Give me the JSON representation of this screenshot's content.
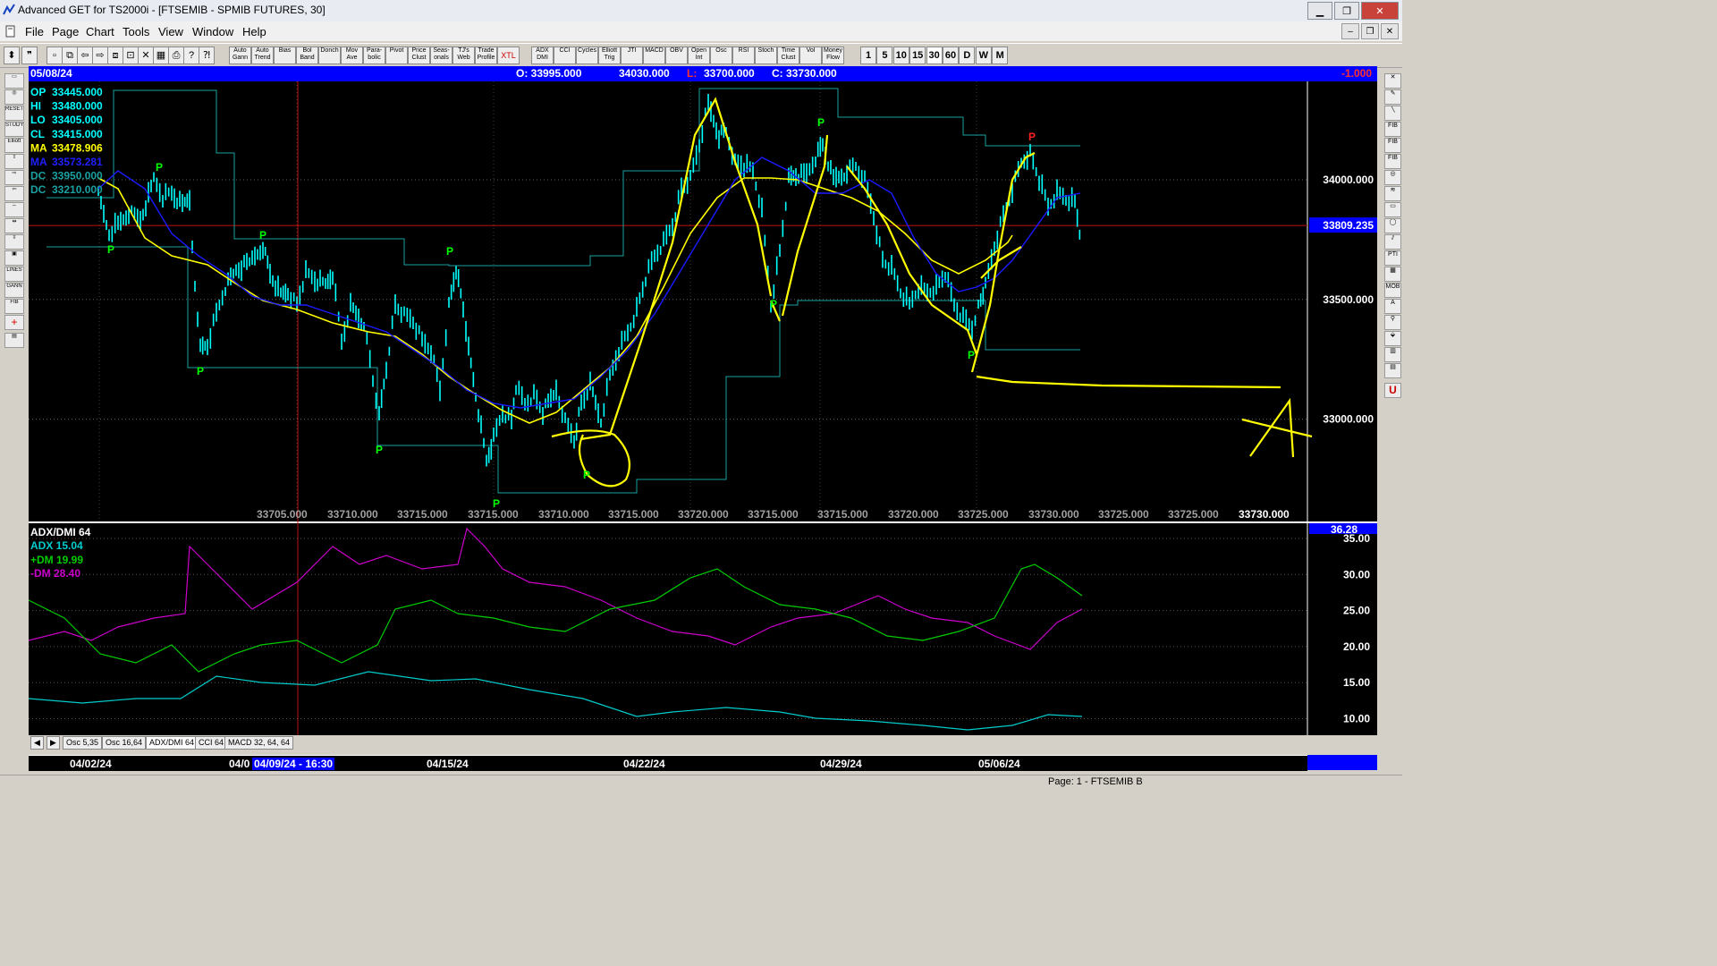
{
  "window": {
    "title": "Advanced GET for TS2000i - [FTSEMIB - SPMIB FUTURES, 30]"
  },
  "menu": [
    "File",
    "Page",
    "Chart",
    "Tools",
    "View",
    "Window",
    "Help"
  ],
  "toolbar": {
    "studies": [
      "Auto Gann",
      "Auto Trend",
      "Bias",
      "Bol Band",
      "Donch",
      "Mov Ave",
      "Para-bolic",
      "Pivot",
      "Price Clust",
      "Seas-onals",
      "TJ's Web",
      "Trade Profile",
      "XTL",
      "ADX DMI",
      "CCI",
      "Cycles",
      "Elliott Trig",
      "JTI",
      "MACD",
      "OBV",
      "Open Int",
      "Osc",
      "RSI",
      "Stoch",
      "Time Clust",
      "Vol",
      "Money Flow"
    ],
    "intervals": [
      "1",
      "5",
      "10",
      "15",
      "30",
      "60",
      "D",
      "W",
      "M"
    ]
  },
  "infobar": {
    "date": "05/08/24",
    "open": "O: 33995.000",
    "high": "34030.000",
    "low_label": "L:",
    "low": "33700.000",
    "close": "C: 33730.000",
    "change": "-1.000"
  },
  "legend": [
    {
      "label": "OP",
      "value": "33445.000",
      "color": "#00ffff"
    },
    {
      "label": "HI",
      "value": "33480.000",
      "color": "#00ffff"
    },
    {
      "label": "LO",
      "value": "33405.000",
      "color": "#00ffff"
    },
    {
      "label": "CL",
      "value": "33415.000",
      "color": "#00ffff"
    },
    {
      "label": "MA",
      "value": "33478.906",
      "color": "#ffff00"
    },
    {
      "label": "MA",
      "value": "33573.281",
      "color": "#2020ff"
    },
    {
      "label": "DC",
      "value": "33950.000",
      "color": "#1aa0a0"
    },
    {
      "label": "DC",
      "value": "33210.000",
      "color": "#1aa0a0"
    }
  ],
  "price_scale": [
    "34000.000",
    "33500.000",
    "33000.000"
  ],
  "current_price": "33809.235",
  "bottom_values": [
    "33705.000",
    "33710.000",
    "33715.000",
    "33715.000",
    "33710.000",
    "33715.000",
    "33720.000",
    "33715.000",
    "33715.000",
    "33720.000",
    "33725.000",
    "33730.000",
    "33725.000",
    "33725.000",
    "33730.000"
  ],
  "pivots": [
    "P",
    "P",
    "P",
    "P",
    "P",
    "P",
    "P",
    "P",
    "P",
    "P",
    "P",
    "P"
  ],
  "indicator": {
    "title": "ADX/DMI 64",
    "adx": "ADX 15.04",
    "pdm": "+DM 19.99",
    "mdm": "-DM 28.40",
    "current": "36.28",
    "scale": [
      "35.00",
      "30.00",
      "25.00",
      "20.00",
      "15.00",
      "10.00"
    ]
  },
  "tabs": [
    "Osc 5,35",
    "Osc 16,64",
    "ADX/DMI 64",
    "CCI 64",
    "MACD 32, 64, 64"
  ],
  "dates": [
    "04/02/24",
    "04/0",
    "04/09/24 - 16:30",
    "04/15/24",
    "04/22/24",
    "04/29/24",
    "05/06/24"
  ],
  "status": "Page: 1 - FTSEMIB B",
  "colors": {
    "background": "#000000",
    "price": "#00ffff",
    "ma_fast": "#ffff00",
    "ma_slow": "#1a1aff",
    "donchian": "#1aa0a0",
    "pdm": "#00cc00",
    "mdm": "#cc00cc",
    "adx": "#00cccc",
    "drawing": "#ffff00",
    "pivot_low": "#00ff00",
    "pivot_high": "#ff2020"
  }
}
